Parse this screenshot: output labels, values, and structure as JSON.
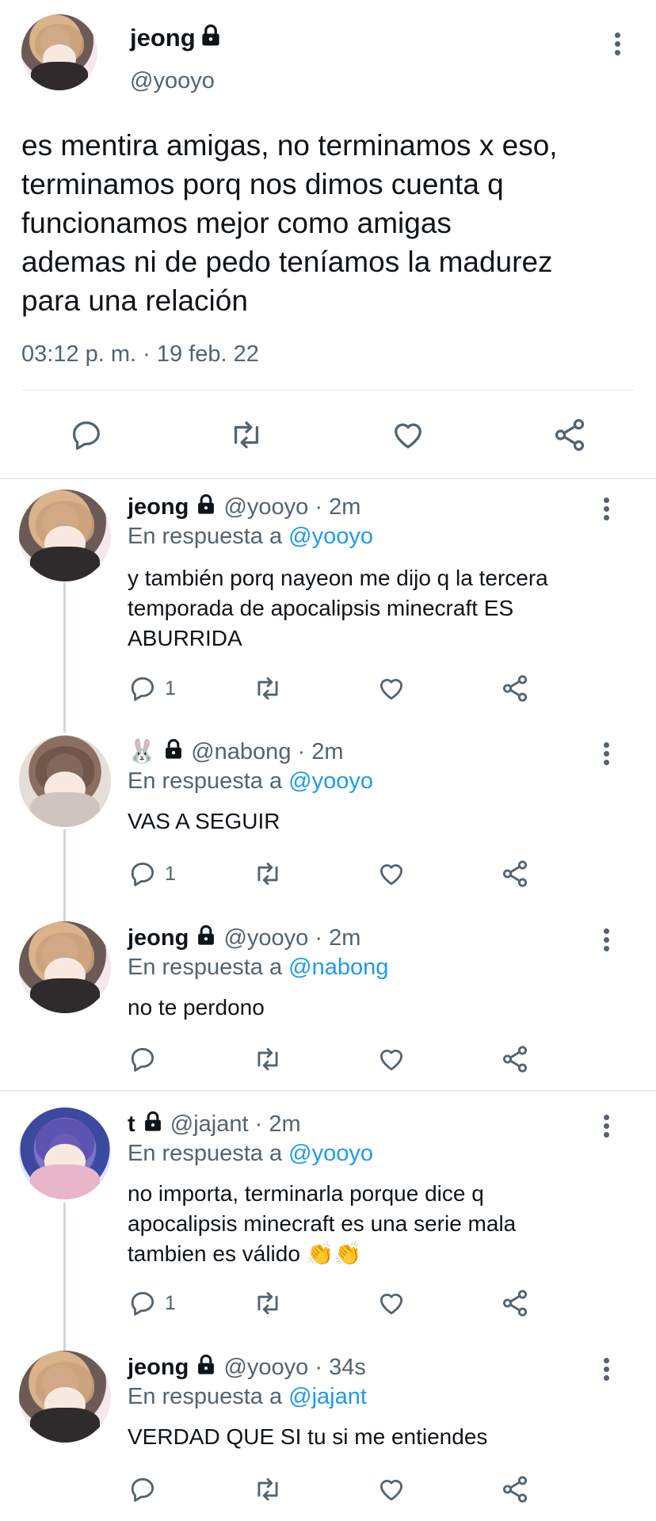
{
  "main_tweet": {
    "name": "jeong",
    "handle": "@yooyo",
    "text": "es mentira amigas, no terminamos x eso,\nterminamos porq nos dimos cuenta q\nfuncionamos mejor como amigas\nademas ni de pedo teníamos la madurez\npara una relación",
    "timestamp": "03:12 p. m. · 19 feb. 22",
    "lock_icon": "lock-icon",
    "actions": [
      "reply-icon",
      "retweet-icon",
      "like-icon",
      "share-icon"
    ]
  },
  "replies": [
    {
      "name": "jeong",
      "handle": "@yooyo",
      "time": "· 2m",
      "replying_prefix": "En respuesta a",
      "replying_to": "@yooyo",
      "text": "y también porq nayeon me dijo q la tercera\ntemporada de apocalipsis minecraft ES\nABURRIDA",
      "reply_count": "1"
    },
    {
      "name": "🐰",
      "handle": "@nabong",
      "time": "· 2m",
      "replying_prefix": "En respuesta a",
      "replying_to": "@yooyo",
      "text": "VAS A SEGUIR",
      "reply_count": "1"
    },
    {
      "name": "jeong",
      "handle": "@yooyo",
      "time": "· 2m",
      "replying_prefix": "En respuesta a",
      "replying_to": "@nabong",
      "text": "no te perdono",
      "reply_count": ""
    },
    {
      "name": "t",
      "handle": "@jajant",
      "time": "· 2m",
      "replying_prefix": "En respuesta a",
      "replying_to": "@yooyo",
      "text": "no importa, terminarla porque dice q\napocalipsis minecraft es una serie mala\ntambien es válido 👏👏",
      "reply_count": "1"
    },
    {
      "name": "jeong",
      "handle": "@yooyo",
      "time": "· 34s",
      "replying_prefix": "En respuesta a",
      "replying_to": "@jajant",
      "text": "VERDAD QUE SI tu si me entiendes",
      "reply_count": ""
    }
  ],
  "colors": {
    "text": "#0f1419",
    "secondary": "#536471",
    "link": "#1d9bf0",
    "divider": "#e1e8ed"
  }
}
